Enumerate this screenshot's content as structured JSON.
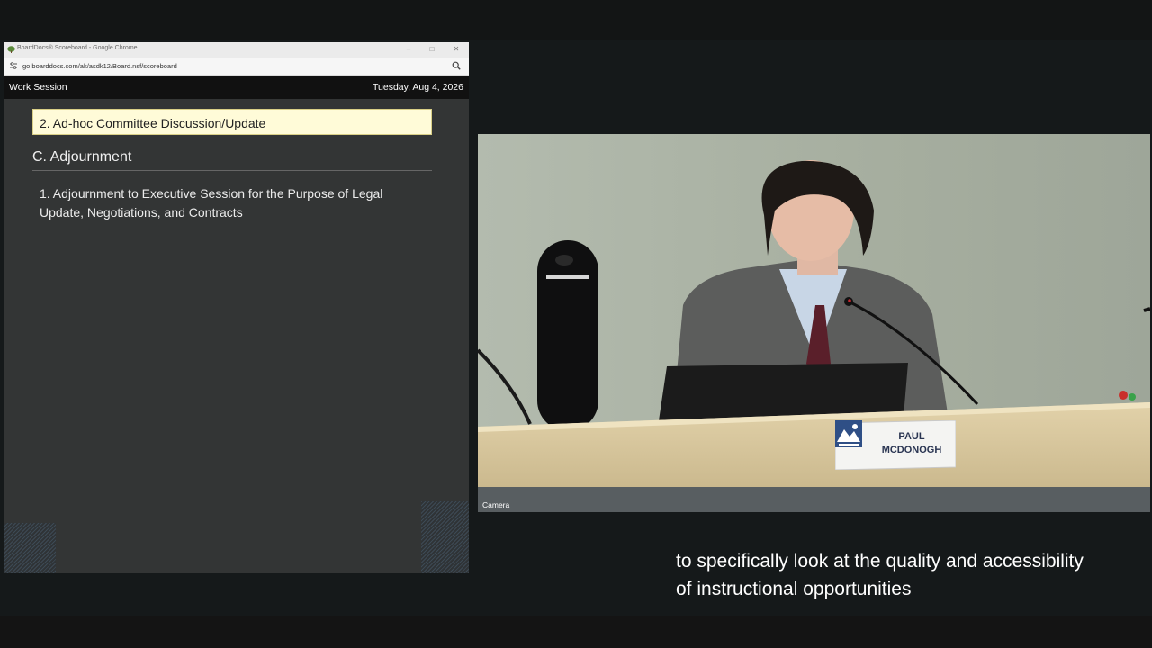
{
  "browser": {
    "window_title": "BoardDocs® Scoreboard - Google Chrome",
    "url": "go.boarddocs.com/ak/asdk12/Board.nsf/scoreboard",
    "controls": {
      "minimize": "–",
      "maximize": "□",
      "close": "✕"
    }
  },
  "scoreboard": {
    "meeting_type": "Work Session",
    "date": "Tuesday, Aug 4, 2026",
    "current_item": "2. Ad-hoc Committee Discussion/Update",
    "section_heading": "C. Adjournment",
    "items": [
      "1. Adjournment to Executive Session for the Purpose of Legal Update, Negotiations, and Contracts"
    ]
  },
  "camera": {
    "label": "Camera",
    "nameplate": {
      "line1": "PAUL",
      "line2": "MCDONOGH"
    }
  },
  "caption": {
    "line1": "to specifically look at the quality and accessibility",
    "line2": "of instructional opportunities"
  },
  "colors": {
    "current_item_bg": "#fffbd8",
    "scoreboard_bg": "#333535",
    "header_bg": "#111111",
    "wall": "#a8b0a4",
    "desk": "#d7c7a0"
  },
  "icons": {
    "tab": "boarddocs-tree-icon",
    "site_info": "site-info-icon",
    "zoom": "zoom-icon",
    "logo": "district-logo-icon"
  }
}
